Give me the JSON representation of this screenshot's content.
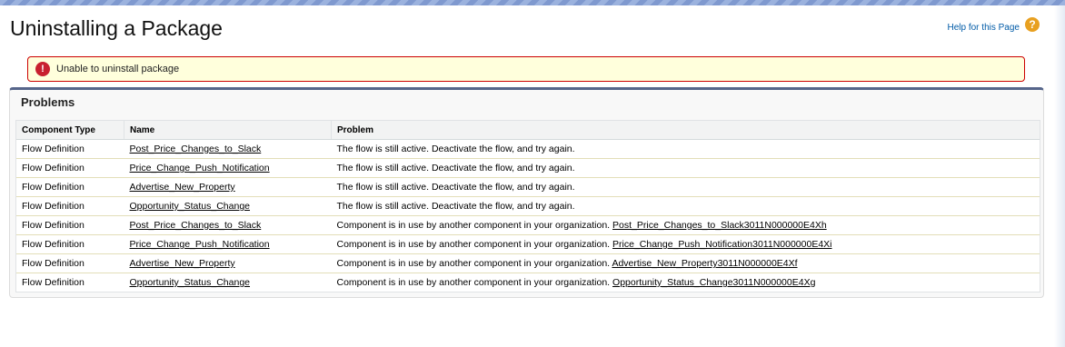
{
  "page": {
    "title": "Uninstalling a Package",
    "help_label": "Help for this Page",
    "help_icon": "help-icon"
  },
  "error": {
    "message": "Unable to uninstall package",
    "icon": "error-icon"
  },
  "problems": {
    "title": "Problems",
    "columns": [
      "Component Type",
      "Name",
      "Problem"
    ],
    "rows": [
      {
        "type": "Flow Definition",
        "name": "Post_Price_Changes_to_Slack",
        "problem": "The flow is still active. Deactivate the flow, and try again.",
        "ref": ""
      },
      {
        "type": "Flow Definition",
        "name": "Price_Change_Push_Notification",
        "problem": "The flow is still active. Deactivate the flow, and try again.",
        "ref": ""
      },
      {
        "type": "Flow Definition",
        "name": "Advertise_New_Property",
        "problem": "The flow is still active. Deactivate the flow, and try again.",
        "ref": ""
      },
      {
        "type": "Flow Definition",
        "name": "Opportunity_Status_Change",
        "problem": "The flow is still active. Deactivate the flow, and try again.",
        "ref": ""
      },
      {
        "type": "Flow Definition",
        "name": "Post_Price_Changes_to_Slack",
        "problem": "Component is in use by another component in your organization.",
        "ref": "Post_Price_Changes_to_Slack3011N000000E4Xh"
      },
      {
        "type": "Flow Definition",
        "name": "Price_Change_Push_Notification",
        "problem": "Component is in use by another component in your organization.",
        "ref": "Price_Change_Push_Notification3011N000000E4Xi"
      },
      {
        "type": "Flow Definition",
        "name": "Advertise_New_Property",
        "problem": "Component is in use by another component in your organization.",
        "ref": "Advertise_New_Property3011N000000E4Xf"
      },
      {
        "type": "Flow Definition",
        "name": "Opportunity_Status_Change",
        "problem": "Component is in use by another component in your organization.",
        "ref": "Opportunity_Status_Change3011N000000E4Xg"
      }
    ]
  }
}
